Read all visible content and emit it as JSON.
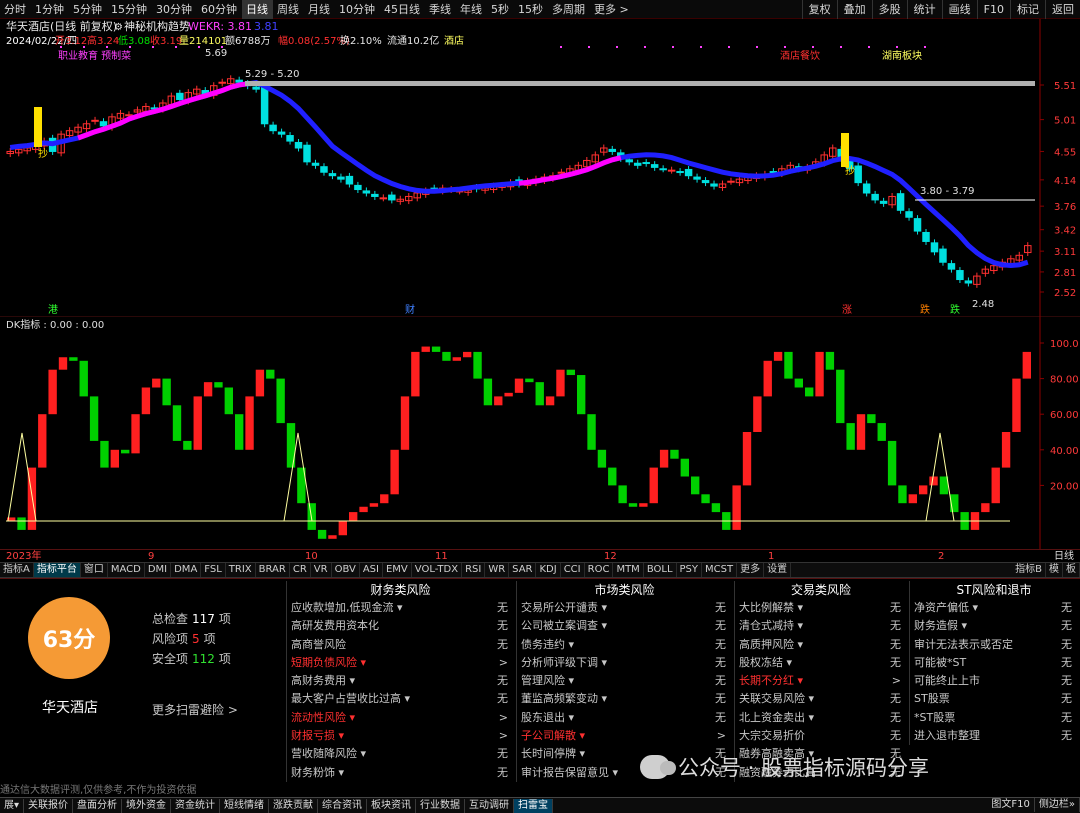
{
  "toolbar": {
    "periods": [
      "分时",
      "1分钟",
      "5分钟",
      "15分钟",
      "30分钟",
      "60分钟",
      "日线",
      "周线",
      "月线",
      "10分钟",
      "45日线",
      "季线",
      "年线",
      "5秒",
      "15秒",
      "多周期",
      "更多 >"
    ],
    "active_period": "日线",
    "tools": [
      "复权",
      "叠加",
      "多股",
      "统计",
      "画线",
      "F10",
      "标记",
      "返回"
    ]
  },
  "header": {
    "title": "华天酒店(日线 前复权)",
    "indicator": "神秘机构趋势",
    "wekr_label": "WEKR: 3.81",
    "wekr_extra": "3.81",
    "info_line": {
      "date": "2024/02/22/四",
      "open": "开3.12",
      "high": "高3.24",
      "low": "低3.08",
      "close": "收3.19",
      "volume": "量214101",
      "amount": "额6788万",
      "change": "幅0.08(2.57%)",
      "turnover": "换2.10%",
      "float": "流通10.2亿",
      "sector": "酒店"
    }
  },
  "main_chart": {
    "y_ticks": [
      "5.51",
      "5.01",
      "4.55",
      "4.14",
      "3.76",
      "3.42",
      "3.11",
      "2.81",
      "2.52"
    ],
    "annotations": {
      "topic1": "职业教育 预制菜",
      "topic2": "酒店餐饮",
      "topic3": "湖南板块",
      "high_price": "5.69",
      "range1": "5.29 - 5.20",
      "range2": "3.80 - 3.79",
      "low_price": "2.48",
      "marker_buy1": "抄",
      "marker_buy2": "抄",
      "event_gang": "港",
      "event_cai": "财",
      "event_zhang": "涨",
      "event_diao": "跌",
      "event_die": "跌"
    },
    "colors": {
      "up": "#ff3030",
      "down": "#00e0e0",
      "trend_up": "#ff00ff",
      "trend_down": "#2020ff",
      "signal": "#ffe000"
    }
  },
  "dk_chart": {
    "title": "DK指标 : 0.00 : 0.00",
    "y_ticks": [
      "100.0",
      "80.00",
      "60.00",
      "40.00",
      "20.00"
    ],
    "colors": {
      "up": "#ff2020",
      "down": "#00d000",
      "line": "#ffffa0"
    }
  },
  "date_axis": [
    "2023年",
    "9",
    "10",
    "11",
    "12",
    "1",
    "2"
  ],
  "date_right": "日线",
  "indicator_tabs": [
    "指标A",
    "指标平台",
    "窗口",
    "MACD",
    "DMI",
    "DMA",
    "FSL",
    "TRIX",
    "BRAR",
    "CR",
    "VR",
    "OBV",
    "ASI",
    "EMV",
    "VOL-TDX",
    "RSI",
    "WR",
    "SAR",
    "KDJ",
    "CCI",
    "ROC",
    "MTM",
    "BOLL",
    "PSY",
    "MCST",
    "更多",
    "设置"
  ],
  "indicator_tabs_selected": "指标平台",
  "indicator_tabs_right": [
    "指标B",
    "模",
    "板"
  ],
  "scan": {
    "score": "63分",
    "stock": "华天酒店",
    "total_label": "总检查",
    "total_value": "117",
    "total_unit": "项",
    "risk_label": "风险项",
    "risk_value": "5",
    "risk_unit": "项",
    "safe_label": "安全项",
    "safe_value": "112",
    "safe_unit": "项",
    "more": "更多扫雷避险 >",
    "columns": [
      {
        "title": "财务类风险",
        "rows": [
          {
            "label": "应收款增加,低现金流 ▾",
            "value": "无",
            "warn": false
          },
          {
            "label": "高研发费用资本化",
            "value": "无",
            "warn": false
          },
          {
            "label": "高商誉风险",
            "value": "无",
            "warn": false
          },
          {
            "label": "短期负债风险 ▾",
            "value": ">",
            "warn": true
          },
          {
            "label": "高财务费用 ▾",
            "value": "无",
            "warn": false
          },
          {
            "label": "最大客户占营收比过高 ▾",
            "value": "无",
            "warn": false
          },
          {
            "label": "流动性风险 ▾",
            "value": ">",
            "warn": true
          },
          {
            "label": "财报亏损 ▾",
            "value": ">",
            "warn": true
          },
          {
            "label": "营收随降风险 ▾",
            "value": "无",
            "warn": false
          },
          {
            "label": "财务粉饰 ▾",
            "value": "无",
            "warn": false
          }
        ]
      },
      {
        "title": "市场类风险",
        "rows": [
          {
            "label": "交易所公开谴责 ▾",
            "value": "无",
            "warn": false
          },
          {
            "label": "公司被立案调查 ▾",
            "value": "无",
            "warn": false
          },
          {
            "label": "债务违约 ▾",
            "value": "无",
            "warn": false
          },
          {
            "label": "分析师评级下调 ▾",
            "value": "无",
            "warn": false
          },
          {
            "label": "管理风险 ▾",
            "value": "无",
            "warn": false
          },
          {
            "label": "董监高频繁变动 ▾",
            "value": "无",
            "warn": false
          },
          {
            "label": "股东退出 ▾",
            "value": "无",
            "warn": false
          },
          {
            "label": "子公司解散 ▾",
            "value": ">",
            "warn": true
          },
          {
            "label": "长时间停牌 ▾",
            "value": "无",
            "warn": false
          },
          {
            "label": "审计报告保留意见 ▾",
            "value": "无",
            "warn": false
          }
        ]
      },
      {
        "title": "交易类风险",
        "rows": [
          {
            "label": "大比例解禁 ▾",
            "value": "无",
            "warn": false
          },
          {
            "label": "清仓式减持 ▾",
            "value": "无",
            "warn": false
          },
          {
            "label": "高质押风险 ▾",
            "value": "无",
            "warn": false
          },
          {
            "label": "股权冻结 ▾",
            "value": "无",
            "warn": false
          },
          {
            "label": "长期不分红 ▾",
            "value": ">",
            "warn": true
          },
          {
            "label": "关联交易风险 ▾",
            "value": "无",
            "warn": false
          },
          {
            "label": "北上资金卖出 ▾",
            "value": "无",
            "warn": false
          },
          {
            "label": "大宗交易折价",
            "value": "无",
            "warn": false
          },
          {
            "label": "融券高融卖高 ▾",
            "value": "无",
            "warn": false
          },
          {
            "label": "融资融券占比高",
            "value": "无",
            "warn": false
          }
        ]
      },
      {
        "title": "ST风险和退市",
        "rows": [
          {
            "label": "净资产偏低 ▾",
            "value": "无",
            "warn": false
          },
          {
            "label": "财务造假 ▾",
            "value": "无",
            "warn": false
          },
          {
            "label": "审计无法表示或否定",
            "value": "无",
            "warn": false
          },
          {
            "label": "可能被*ST",
            "value": "无",
            "warn": false
          },
          {
            "label": "可能终止上市",
            "value": "无",
            "warn": false
          },
          {
            "label": "ST股票",
            "value": "无",
            "warn": false
          },
          {
            "label": "*ST股票",
            "value": "无",
            "warn": false
          },
          {
            "label": "进入退市整理",
            "value": "无",
            "warn": false
          }
        ]
      }
    ],
    "disclaimer": "通达信大数据评测,仅供参考,不作为投资依据"
  },
  "watermark": "公众号 · 股票指标源码分享",
  "bottom_tabs": [
    "展▾",
    "关联报价",
    "盘面分析",
    "境外资金",
    "资金统计",
    "短线情绪",
    "涨跌贡献",
    "综合资讯",
    "板块资讯",
    "行业数据",
    "互动调研",
    "扫雷宝"
  ],
  "bottom_tabs_selected": "扫雷宝",
  "bottom_right": [
    "图文F10",
    "侧边栏»"
  ]
}
